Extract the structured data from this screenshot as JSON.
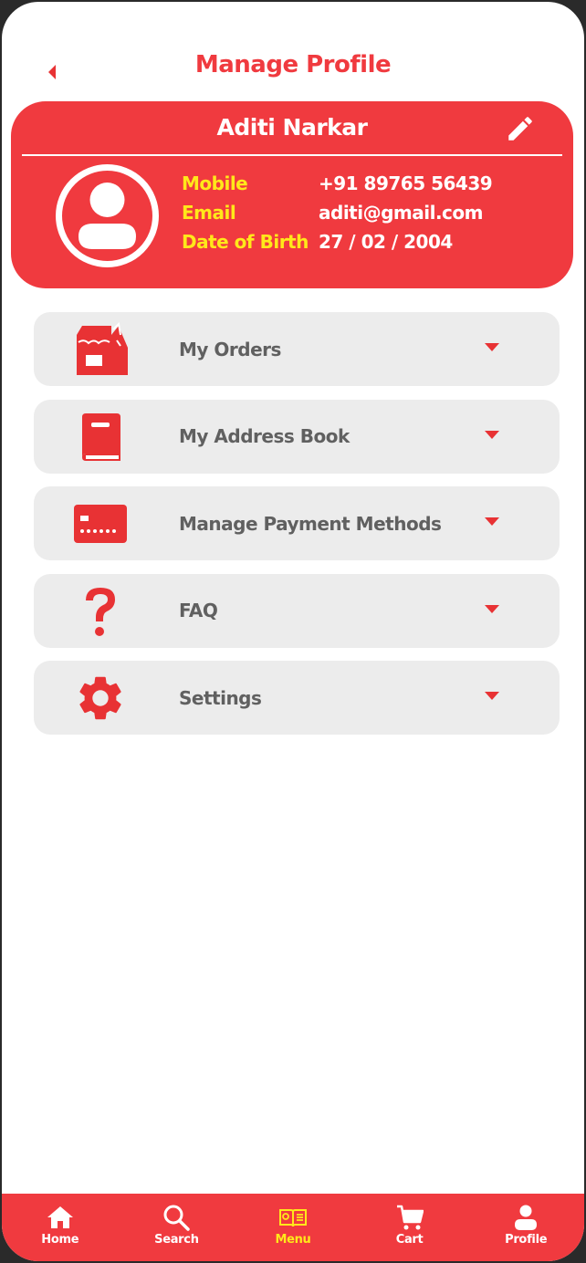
{
  "header": {
    "title": "Manage Profile",
    "back_icon": "back-arrow-icon"
  },
  "profile": {
    "name": "Aditi Narkar",
    "edit_icon": "pencil-icon",
    "avatar_icon": "user-avatar-icon",
    "fields": [
      {
        "label": "Mobile",
        "value": "+91 89765 56439"
      },
      {
        "label": "Email",
        "value": "aditi@gmail.com"
      },
      {
        "label": "Date of Birth",
        "value": "27 / 02 / 2004"
      }
    ]
  },
  "menu": {
    "items": [
      {
        "label": "My Orders",
        "icon": "shop-bag-icon"
      },
      {
        "label": "My Address Book",
        "icon": "book-icon"
      },
      {
        "label": "Manage Payment Methods",
        "icon": "credit-card-icon"
      },
      {
        "label": "FAQ",
        "icon": "question-mark-icon"
      },
      {
        "label": "Settings",
        "icon": "gear-icon"
      }
    ]
  },
  "bottom_nav": {
    "items": [
      {
        "label": "Home",
        "icon": "home-icon",
        "active": false
      },
      {
        "label": "Search",
        "icon": "search-icon",
        "active": false
      },
      {
        "label": "Menu",
        "icon": "menu-book-icon",
        "active": true
      },
      {
        "label": "Cart",
        "icon": "cart-icon",
        "active": false
      },
      {
        "label": "Profile",
        "icon": "profile-icon",
        "active": false
      }
    ]
  },
  "colors": {
    "primary": "#f03a3f",
    "accent": "#ffe81a",
    "card_bg": "#ececec",
    "text_gray": "#606060"
  }
}
